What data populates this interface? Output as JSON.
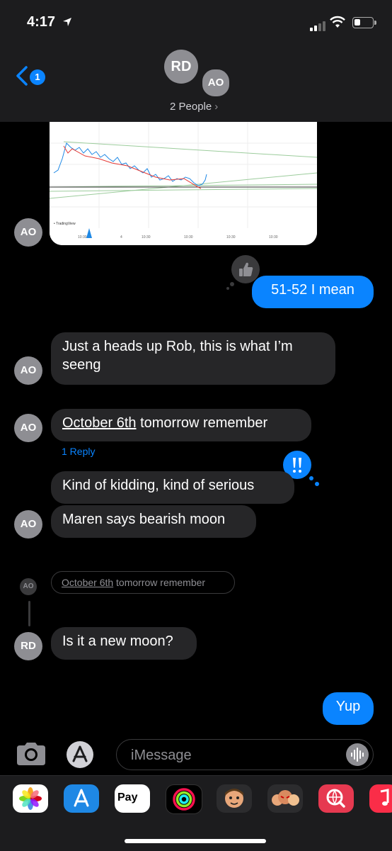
{
  "status_bar": {
    "time": "4:17"
  },
  "header": {
    "back_badge": "1",
    "avatar_main": "RD",
    "avatar_secondary": "AO",
    "people_label": "2 People"
  },
  "messages": {
    "out_1": "51-52 I mean",
    "in_1": "Just a heads up Rob, this is what I’m seeng",
    "in_2_link": "October 6th",
    "in_2_rest": " tomorrow remember",
    "reply_count": "1 Reply",
    "in_3": "Kind of kidding, kind of serious",
    "in_4": "Maren says bearish moon",
    "quoted_link": "October 6th",
    "quoted_rest": " tomorrow remember",
    "in_5": "Is it a new moon?",
    "out_2": "Yup"
  },
  "avatars": {
    "ao": "AO",
    "rd": "RD"
  },
  "composer": {
    "placeholder": "iMessage"
  },
  "drawer": {
    "applepay_label": "Pay"
  },
  "colors": {
    "accent": "#0a84ff",
    "incoming": "#262628",
    "background": "#000000"
  }
}
